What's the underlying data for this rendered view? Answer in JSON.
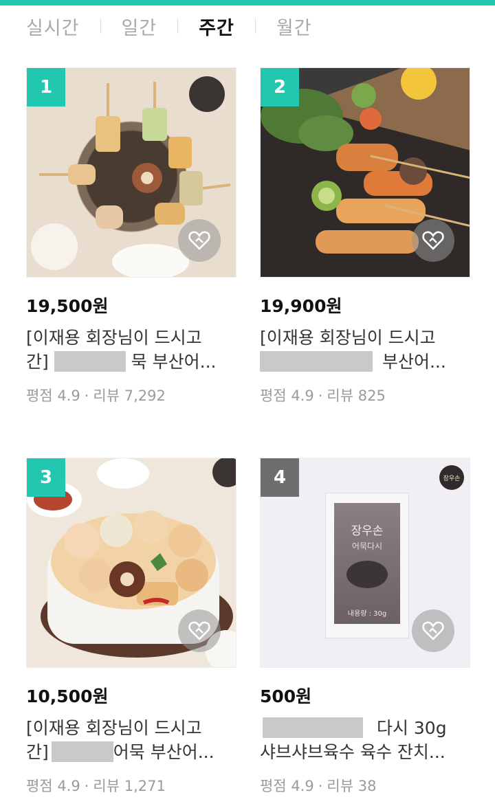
{
  "tabs": [
    {
      "label": "실시간",
      "active": false
    },
    {
      "label": "일간",
      "active": false
    },
    {
      "label": "주간",
      "active": true
    },
    {
      "label": "월간",
      "active": false
    }
  ],
  "colors": {
    "accent": "#22c7b0",
    "badge_gray": "#6e6e6e"
  },
  "products": [
    {
      "rank": "1",
      "price": "19,500원",
      "title_line1": "[이재용 회장님이 드시고",
      "title_line2_prefix": "간]",
      "title_line2_suffix": "묵 부산어...",
      "rating_label": "평점 4.9",
      "review_label": "리뷰 7,292"
    },
    {
      "rank": "2",
      "price": "19,900원",
      "title_line1": "[이재용 회장님이 드시고",
      "title_line2_prefix": "",
      "title_line2_suffix": "부산어...",
      "rating_label": "평점 4.9",
      "review_label": "리뷰 825"
    },
    {
      "rank": "3",
      "price": "10,500원",
      "title_line1": "[이재용 회장님이 드시고",
      "title_line2_prefix": "간]",
      "title_line2_suffix": "어묵 부산어...",
      "rating_label": "평점 4.9",
      "review_label": "리뷰 1,271"
    },
    {
      "rank": "4",
      "price": "500원",
      "title_line1_suffix": "다시 30g",
      "title_line2": "샤브샤브육수 육수 잔치...",
      "rating_label": "평점 4.9",
      "review_label": "리뷰 38",
      "package_texts": [
        "장우손",
        "어묵다시",
        "내용량 : 30g"
      ]
    }
  ],
  "brand_logo_text": "장우손"
}
